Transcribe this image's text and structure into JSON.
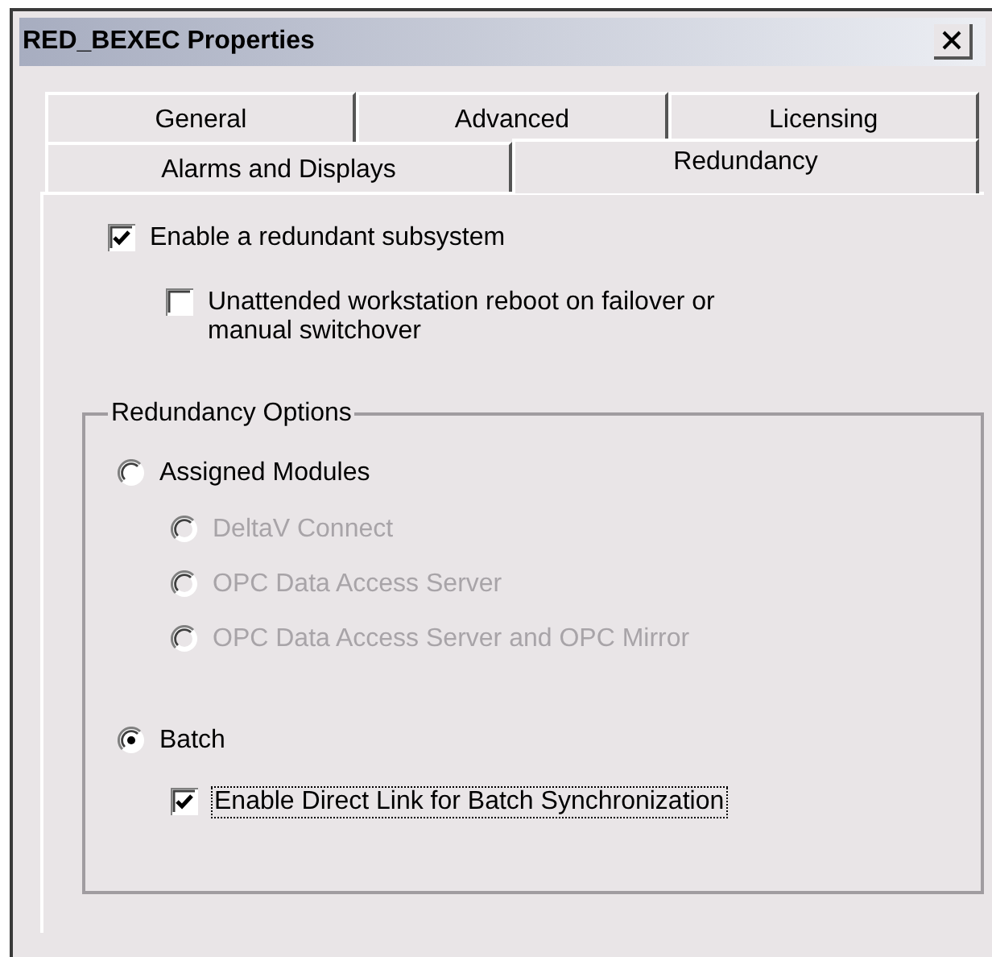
{
  "window": {
    "title": "RED_BEXEC Properties"
  },
  "tab_rows": [
    {
      "tabs": [
        {
          "label": "General",
          "selected": false
        },
        {
          "label": "Advanced",
          "selected": false
        },
        {
          "label": "Licensing",
          "selected": false
        }
      ]
    },
    {
      "tabs": [
        {
          "label": "Alarms and Displays",
          "selected": false
        },
        {
          "label": "Redundancy",
          "selected": true
        }
      ]
    }
  ],
  "options": [
    {
      "kind": "checkbox",
      "label": "Enable a redundant subsystem",
      "checked": true,
      "disabled": false,
      "children": [
        {
          "kind": "checkbox",
          "label": "Unattended workstation reboot on failover or manual switchover",
          "checked": false,
          "disabled": false
        }
      ]
    }
  ],
  "redundancy_options": {
    "title": "Redundancy Options",
    "items": [
      {
        "kind": "radio",
        "label": "Assigned Modules",
        "selected": false,
        "disabled": false,
        "children": [
          {
            "kind": "radio",
            "label": "DeltaV Connect",
            "selected": false,
            "disabled": true
          },
          {
            "kind": "radio",
            "label": "OPC Data Access Server",
            "selected": false,
            "disabled": true
          },
          {
            "kind": "radio",
            "label": "OPC Data Access Server and OPC Mirror",
            "selected": false,
            "disabled": true
          }
        ]
      },
      {
        "kind": "radio",
        "label": "Batch",
        "selected": true,
        "disabled": false,
        "children": [
          {
            "kind": "checkbox",
            "label": "Enable Direct Link for Batch Synchronization",
            "checked": true,
            "disabled": false,
            "focused": true
          }
        ]
      }
    ]
  }
}
